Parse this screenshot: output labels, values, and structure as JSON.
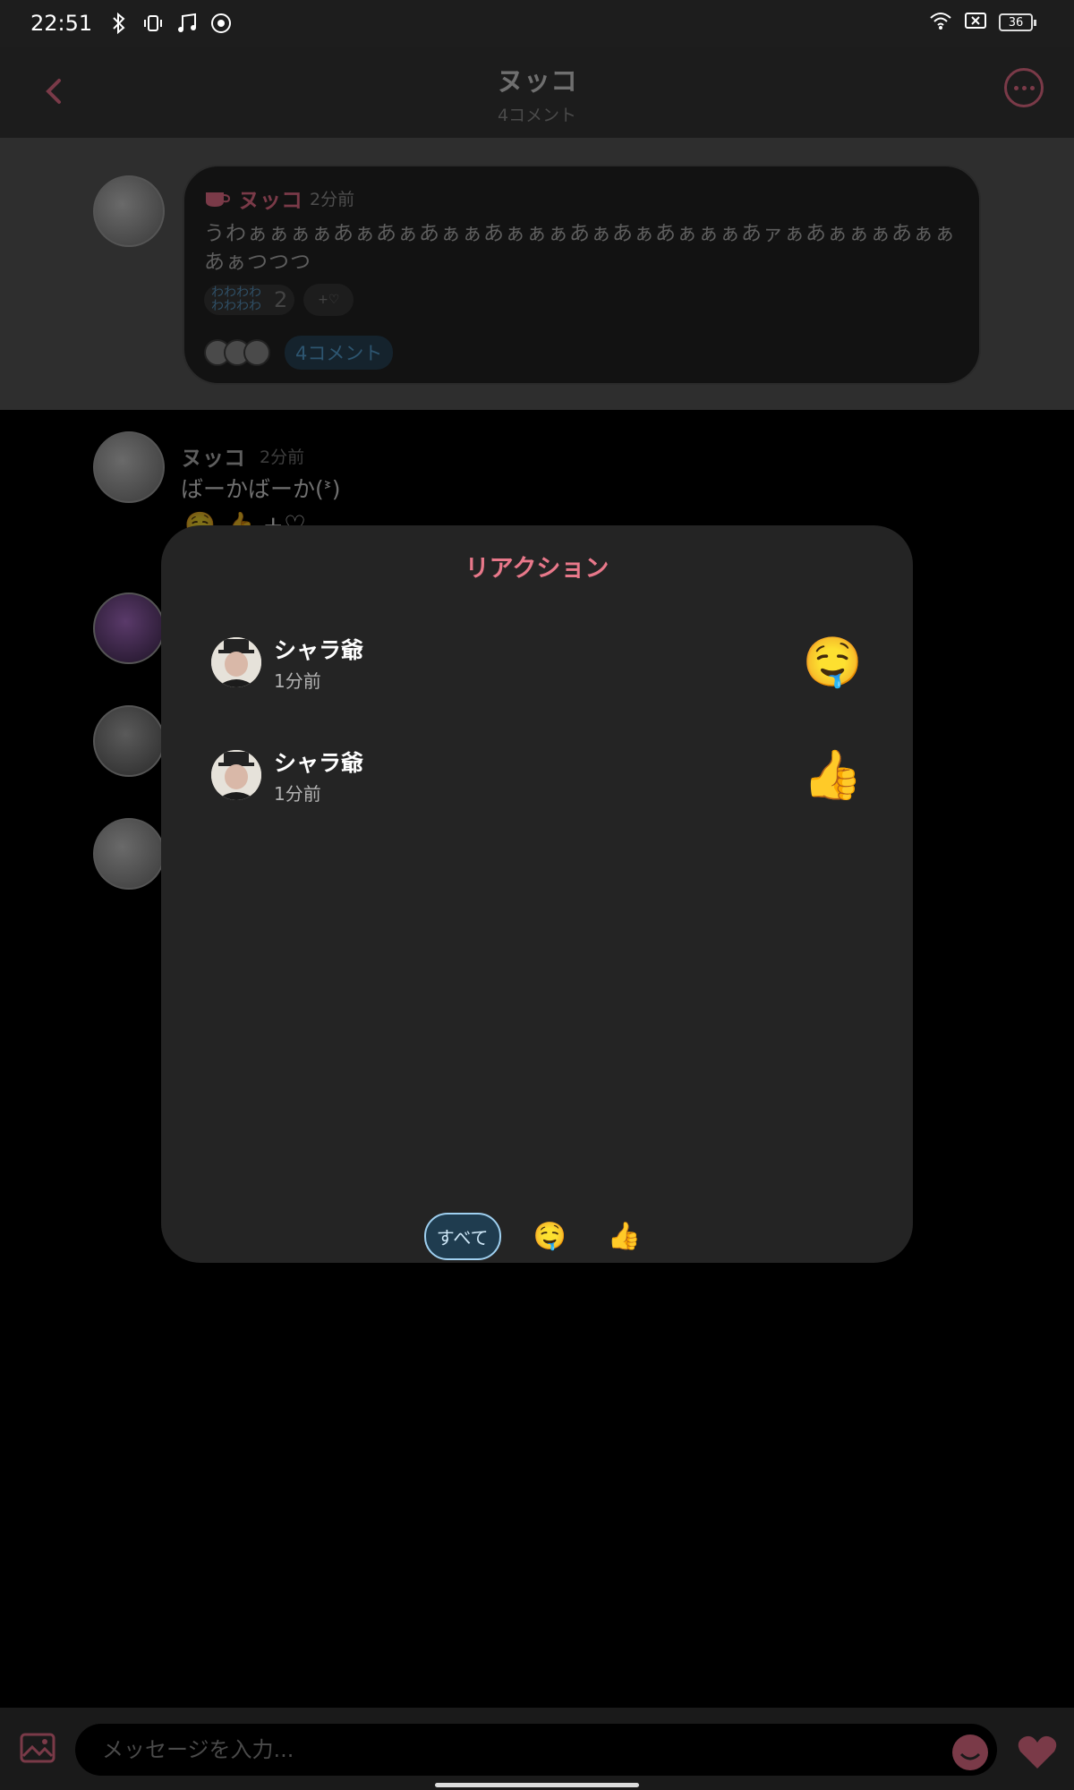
{
  "status_bar": {
    "time": "22:51",
    "battery": "36"
  },
  "header": {
    "title": "ヌッコ",
    "subtitle": "4コメント"
  },
  "post": {
    "author": "ヌッコ",
    "time": "2分前",
    "body": "うわぁぁぁぁあぁあぁあぁぁあぁぁぁあぁあぁあぁぁぁあァぁあぁぁぁあぁぁあぁつつつ",
    "reaction_chip": {
      "label": "わわわわわわわわ",
      "count": "2"
    },
    "add_reaction": "+♡",
    "comment_count_label": "4コメント"
  },
  "comment": {
    "author": "ヌッコ",
    "time": "2分前",
    "text": "ばーかばーか(ᕑ)",
    "reactions": "🤤 👍 +♡"
  },
  "modal": {
    "title": "リアクション",
    "rows": [
      {
        "name": "シャラ爺",
        "time": "1分前",
        "emoji": "🤤"
      },
      {
        "name": "シャラ爺",
        "time": "1分前",
        "emoji": "👍"
      }
    ],
    "tabs": {
      "all": "すべて",
      "emoji1": "🤤",
      "emoji2": "👍"
    }
  },
  "input": {
    "placeholder": "メッセージを入力..."
  },
  "colors": {
    "accent": "#e8788a",
    "dim_accent": "#7a3a48",
    "link": "#2d5570",
    "modal_bg": "#242424"
  }
}
